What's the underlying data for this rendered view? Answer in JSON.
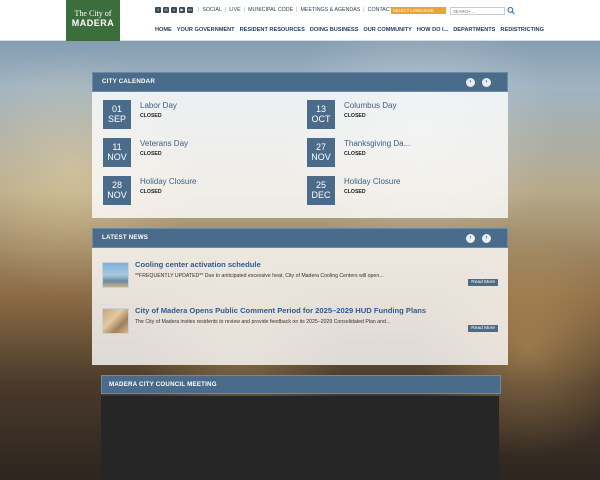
{
  "header": {
    "logo": {
      "line1": "The City of",
      "line2": "MADERA"
    },
    "utility_links": [
      "SOCIAL",
      "LIVE",
      "MUNICIPAL CODE",
      "MEETINGS & AGENDAS",
      "CONTACT"
    ],
    "social_icons": [
      "facebook-icon",
      "instagram-icon",
      "x-icon",
      "youtube-icon",
      "linkedin-icon"
    ],
    "language_select": "SELECT LANGUAGE",
    "search_placeholder": "SEARCH ...",
    "nav": [
      "HOME",
      "YOUR GOVERNMENT",
      "RESIDENT RESOURCES",
      "DOING BUSINESS",
      "OUR COMMUNITY",
      "HOW DO I...",
      "DEPARTMENTS",
      "REDISTRICTING"
    ]
  },
  "calendar": {
    "title": "CITY CALENDAR",
    "prev": "‹",
    "next": "›",
    "events": [
      {
        "day": "01",
        "month": "SEP",
        "name": "Labor Day",
        "status": "CLOSED"
      },
      {
        "day": "13",
        "month": "OCT",
        "name": "Columbus Day",
        "status": "CLOSED"
      },
      {
        "day": "11",
        "month": "NOV",
        "name": "Veterans Day",
        "status": "CLOSED"
      },
      {
        "day": "27",
        "month": "NOV",
        "name": "Thanksgiving Da...",
        "status": "CLOSED"
      },
      {
        "day": "28",
        "month": "NOV",
        "name": "Holiday Closure",
        "status": "CLOSED"
      },
      {
        "day": "25",
        "month": "DEC",
        "name": "Holiday Closure",
        "status": "CLOSED"
      }
    ]
  },
  "news": {
    "title": "LATEST NEWS",
    "prev": "‹",
    "next": "›",
    "items": [
      {
        "title": "Cooling center activation schedule",
        "summary": "**FREQUENTLY UPDATED** Due to anticipated excessive heat, City of Madera Cooling Centers will open...",
        "read_more": "Read More"
      },
      {
        "title": "City of Madera Opens Public Comment Period for 2025–2029 HUD Funding Plans",
        "summary": "The City of Madera invites residents to review and provide feedback on its 2025–2029 Consolidated Plan and...",
        "read_more": "Read More"
      }
    ]
  },
  "meeting": {
    "title": "MADERA CITY COUNCIL MEETING"
  },
  "colors": {
    "accent": "#4a6b8a",
    "logo_green": "#3c6e3d",
    "language_orange": "#e8a33a"
  }
}
